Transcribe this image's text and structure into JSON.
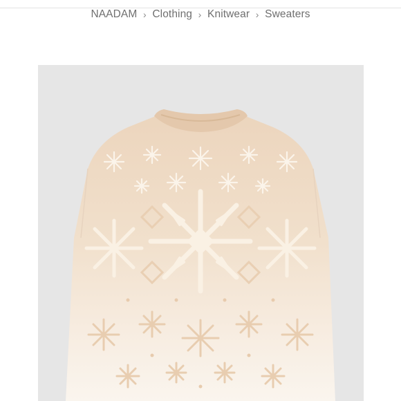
{
  "breadcrumb": {
    "items": [
      {
        "label": "NAADAM"
      },
      {
        "label": "Clothing"
      },
      {
        "label": "Knitwear"
      },
      {
        "label": "Sweaters"
      }
    ],
    "separator_icon": "chevron-right-icon"
  },
  "product_image": {
    "background_color": "#e6e6e6",
    "sweater_colors": {
      "beige": "#ecd6c0",
      "cream": "#f7efe4",
      "ivory": "#fbf7f0"
    }
  }
}
